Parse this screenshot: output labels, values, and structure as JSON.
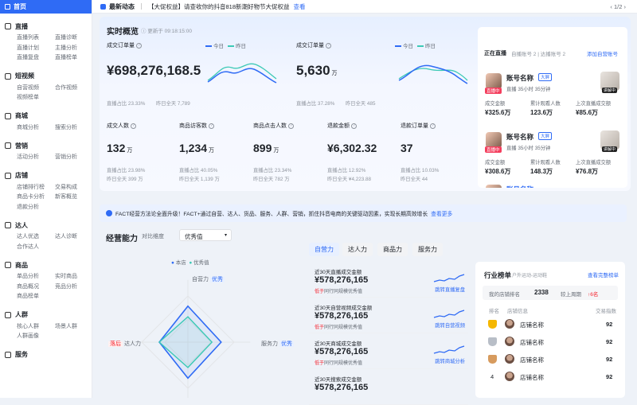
{
  "sidebar": {
    "home": "首页",
    "groups": [
      {
        "title": "直播",
        "items": [
          "直播列表",
          "直播诊断",
          "直播计划",
          "主播分析",
          "直播复盘",
          "直播榜单"
        ]
      },
      {
        "title": "短视频",
        "items": [
          "自营视频",
          "合作视频",
          "视频榜单"
        ]
      },
      {
        "title": "商城",
        "items": [
          "商城分析",
          "搜索分析"
        ]
      },
      {
        "title": "营销",
        "items": [
          "活动分析",
          "营销分析"
        ]
      },
      {
        "title": "店铺",
        "items": [
          "店铺排行榜",
          "交易构成",
          "商品卡分析",
          "新客概览",
          "退款分析"
        ]
      },
      {
        "title": "达人",
        "items": [
          "达人优选",
          "达人诊断",
          "合作达人"
        ]
      },
      {
        "title": "商品",
        "items": [
          "单品分析",
          "实时商品",
          "商品概况",
          "竞品分析",
          "商品榜单"
        ]
      },
      {
        "title": "人群",
        "items": [
          "核心人群",
          "场景人群",
          "人群画像"
        ]
      },
      {
        "title": "服务",
        "items": []
      }
    ]
  },
  "topbar": {
    "title": "最新动态",
    "message": "【大促权益】请查收你的抖音818新潮好物节大促权益",
    "view": "查看",
    "page": "1/2"
  },
  "overview": {
    "title": "实时概览",
    "updated": "更新于 09:18:15:00",
    "legend_today": "今日",
    "legend_yesterday": "昨日",
    "gmv": {
      "label": "成交订单量",
      "value": "¥698,276,168.5",
      "sub1": "直播占比 23.33%",
      "sub2": "昨日全天 7,789"
    },
    "orders": {
      "label": "成交订单量",
      "value": "5,630",
      "unit": "万",
      "sub1": "直播占比 37.28%",
      "sub2": "昨日全天 485"
    },
    "metrics": [
      {
        "label": "成交人数",
        "value": "132",
        "unit": "万",
        "sub1": "直播占比 23.98%",
        "sub2": "昨日全天 399 万"
      },
      {
        "label": "商品访客数",
        "value": "1,234",
        "unit": "万",
        "sub1": "直播占比 40.05%",
        "sub2": "昨日全天 1,139 万"
      },
      {
        "label": "商品点击人数",
        "value": "899",
        "unit": "万",
        "sub1": "直播占比 23.34%",
        "sub2": "昨日全天 782 万"
      },
      {
        "label": "退款金额",
        "value": "¥6,302.32",
        "unit": "",
        "sub1": "直播占比 12.92%",
        "sub2": "昨日全天 ¥4,223.88"
      },
      {
        "label": "退款订单量",
        "value": "37",
        "unit": "",
        "sub1": "直播占比 10.03%",
        "sub2": "昨日全天 44"
      }
    ]
  },
  "live": {
    "title": "正在直播",
    "tabs": "自播账号 2 | 达播账号 2",
    "add": "添加自营账号",
    "accounts": [
      {
        "name": "账号名称",
        "tag": "大屏",
        "badge": "直播中",
        "meta": "直播 35小时 35分钟",
        "speak": "讲解中",
        "stats": [
          {
            "t": "成交金额",
            "v": "¥325.6万"
          },
          {
            "t": "累计观看人数",
            "v": "123.6万"
          },
          {
            "t": "上次直播成交额",
            "v": "¥85.6万"
          }
        ]
      },
      {
        "name": "账号名称",
        "tag": "大屏",
        "badge": "直播中",
        "meta": "直播 35小时 35分钟",
        "speak": "讲解中",
        "stats": [
          {
            "t": "成交金额",
            "v": "¥308.6万"
          },
          {
            "t": "累计观看人数",
            "v": "148.3万"
          },
          {
            "t": "上次直播成交额",
            "v": "¥76.8万"
          }
        ]
      }
    ],
    "more_name": "账号名称"
  },
  "banner": {
    "text": "FACT经营方法论全面升级！FACT+通过自营、达人、货品、服务、人群、营销，抓住抖音电商的关键驱动因素，实现长期高效增长",
    "link": "查看更多"
  },
  "ability": {
    "title": "经营能力",
    "compare": "对比维度",
    "select": "优秀值",
    "legend_a": "本店",
    "legend_b": "优秀值",
    "axes": {
      "top": "自营力",
      "top_tag": "优秀",
      "right": "服务力",
      "right_tag": "优秀",
      "left": "达人力",
      "left_tag": "落后"
    },
    "tabs": [
      "自营力",
      "达人力",
      "商品力",
      "服务力"
    ]
  },
  "radar_data": {
    "axes": [
      "自营力",
      "服务力",
      "商品力",
      "达人力"
    ],
    "store": [
      0.78,
      0.72,
      0.78,
      0.62
    ],
    "excellent": [
      0.55,
      0.52,
      0.55,
      0.62
    ]
  },
  "metric_cards": [
    {
      "title": "近30天直播成交金额",
      "value": "¥578,276,165",
      "rank_pre": "低于",
      "rank": "同行同规模优秀值",
      "link": "跳转直播复盘"
    },
    {
      "title": "近30天自营视频成交金额",
      "value": "¥578,276,165",
      "rank_pre": "低于",
      "rank": "同行同规模优秀值",
      "link": "跳转自营视频"
    },
    {
      "title": "近30天商城成交金额",
      "value": "¥578,276,165",
      "rank_pre": "低于",
      "rank": "同行同规模优秀值",
      "link": "跳转商城分析"
    },
    {
      "title": "近30天搜索成交金额",
      "value": "¥578,276,165"
    }
  ],
  "rank": {
    "title": "行业榜单",
    "subtitle": "户外运动-运动鞋",
    "more": "查看完整榜单",
    "my_rank_label": "我的店铺排名",
    "my_rank": "2338",
    "compare": "较上周期",
    "change": "↑6名",
    "headers": [
      "排名",
      "店铺信息",
      "交易指数"
    ],
    "rows": [
      {
        "rank": "1",
        "name": "店铺名称",
        "val": "92"
      },
      {
        "rank": "2",
        "name": "店铺名称",
        "val": "92"
      },
      {
        "rank": "3",
        "name": "店铺名称",
        "val": "92"
      },
      {
        "rank": "4",
        "name": "店铺名称",
        "val": "92"
      }
    ]
  },
  "colors": {
    "primary": "#2f6bf5",
    "teal": "#3cc9b6",
    "red": "#f5222d"
  }
}
